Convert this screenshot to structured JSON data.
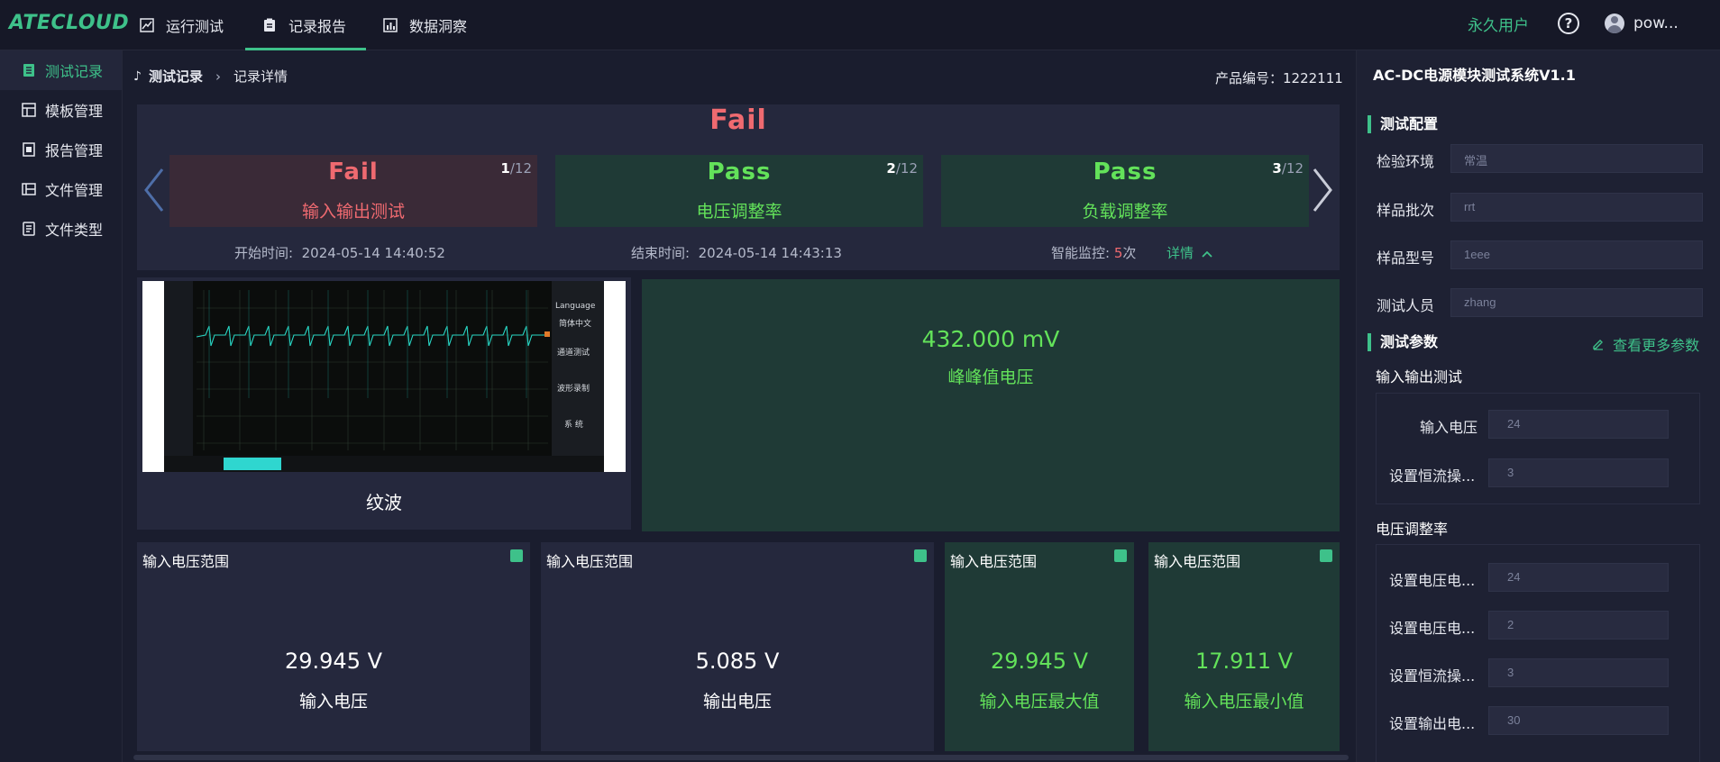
{
  "app": {
    "logo": "ATECLOUD",
    "nav": [
      {
        "label": "运行测试",
        "icon": "chart-line-icon"
      },
      {
        "label": "记录报告",
        "icon": "clipboard-icon"
      },
      {
        "label": "数据洞察",
        "icon": "bar-chart-icon"
      }
    ],
    "user_type": "永久用户",
    "username": "pow..."
  },
  "sidebar": {
    "items": [
      {
        "label": "测试记录",
        "icon": "file-list-icon"
      },
      {
        "label": "模板管理",
        "icon": "grid-icon"
      },
      {
        "label": "报告管理",
        "icon": "report-icon"
      },
      {
        "label": "文件管理",
        "icon": "folder-icon"
      },
      {
        "label": "文件类型",
        "icon": "file-type-icon"
      }
    ]
  },
  "breadcrumb": {
    "root": "测试记录",
    "current": "记录详情"
  },
  "product": "产品编号：1222111",
  "summary": {
    "overall": "Fail",
    "cards": [
      {
        "status": "Fail",
        "name": "输入输出测试",
        "index": "1",
        "total": "/12"
      },
      {
        "status": "Pass",
        "name": "电压调整率",
        "index": "2",
        "total": "/12"
      },
      {
        "status": "Pass",
        "name": "负载调整率",
        "index": "3",
        "total": "/12"
      }
    ],
    "start_label": "开始时间:",
    "start_value": "2024-05-14 14:40:52",
    "end_label": "结束时间:",
    "end_value": "2024-05-14 14:43:13",
    "monitor_label": "智能监控:",
    "monitor_count": "5",
    "monitor_unit": "次",
    "detail_link": "详情"
  },
  "scope": {
    "label": "纹波",
    "menu": [
      "Language",
      "简体中文",
      "通道测试",
      "波形录制",
      "系 统"
    ]
  },
  "ripple": {
    "value": "432.000  mV",
    "name": "峰峰值电压"
  },
  "metrics": [
    {
      "title": "输入电压范围",
      "value": "29.945  V",
      "name": "输入电压"
    },
    {
      "title": "输入电压范围",
      "value": "5.085  V",
      "name": "输出电压"
    },
    {
      "title": "输入电压范围",
      "value": "29.945  V",
      "name": "输入电压最大值"
    },
    {
      "title": "输入电压范围",
      "value": "17.911  V",
      "name": "输入电压最小值"
    }
  ],
  "right_panel": {
    "title": "AC-DC电源模块测试系统V1.1",
    "config_section": "测试配置",
    "config": [
      {
        "label": "检验环境",
        "value": "常温"
      },
      {
        "label": "样品批次",
        "value": "rrt"
      },
      {
        "label": "样品型号",
        "value": "1eee"
      },
      {
        "label": "测试人员",
        "value": "zhang"
      }
    ],
    "params_section": "测试参数",
    "more_link": "查看更多参数",
    "group1_title": "输入输出测试",
    "group1": [
      {
        "label": "输入电压",
        "value": "24"
      },
      {
        "label": "设置恒流操...",
        "value": "3"
      }
    ],
    "group2_title": "电压调整率",
    "group2": [
      {
        "label": "设置电压电...",
        "value": "24"
      },
      {
        "label": "设置电压电...",
        "value": "2"
      },
      {
        "label": "设置恒流操...",
        "value": "3"
      },
      {
        "label": "设置输出电...",
        "value": "30"
      }
    ]
  },
  "colors": {
    "accent": "#3ec18a",
    "pass": "#63e25a",
    "fail": "#ef6a70",
    "bg": "#1a1d2e"
  }
}
